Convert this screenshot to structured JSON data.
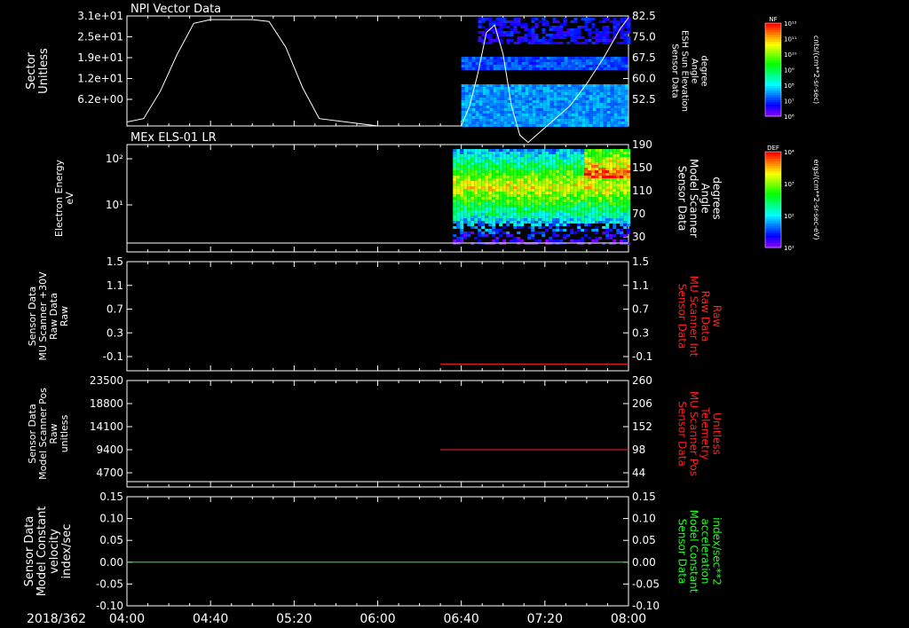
{
  "panels": [
    {
      "title": "NPI Vector Data",
      "left_label": [
        "Sector",
        "Unitless"
      ],
      "left_ticks": [
        "3.1e+01",
        "2.5e+01",
        "1.9e+01",
        "1.2e+01",
        "6.2e+00"
      ],
      "right_label": [
        "Sensor Data",
        "ESH Sun Elevation",
        "Angle",
        "degree"
      ],
      "right_ticks": [
        "82.5",
        "75.0",
        "67.5",
        "60.0",
        "52.5"
      ],
      "colorbar": {
        "label": "NF",
        "unit": "cnts/(cm**2-sr-sec)",
        "ticks": [
          "10¹²",
          "10¹¹",
          "10¹⁰",
          "10⁹",
          "10⁸",
          "10⁷",
          "10⁶"
        ]
      }
    },
    {
      "title": "MEx ELS-01 LR",
      "left_label": [
        "Electron Energy",
        "eV"
      ],
      "left_ticks": [
        "10²",
        "10¹"
      ],
      "right_label": [
        "Sensor Data",
        "Model Scanner",
        "Angle",
        "degrees"
      ],
      "right_ticks": [
        "190",
        "150",
        "110",
        "70",
        "30"
      ],
      "colorbar": {
        "label": "DEF",
        "unit": "ergs/(cm**2-sr-sec-eV)",
        "ticks": [
          "10⁴",
          "10³",
          "10²",
          "10¹"
        ]
      }
    },
    {
      "title": "",
      "left_label": [
        "Sensor Data",
        "MU Scanner +30V",
        "Raw Data",
        "Raw"
      ],
      "left_ticks": [
        "1.5",
        "1.1",
        "0.7",
        "0.3",
        "-0.1"
      ],
      "right_label": [
        "Sensor Data",
        "MU Scanner Int",
        "Raw Data",
        "Raw"
      ],
      "right_ticks": [
        "1.5",
        "1.1",
        "0.7",
        "0.3",
        "-0.1"
      ]
    },
    {
      "title": "",
      "left_label": [
        "Sensor Data",
        "Model Scanner Pos",
        "Raw",
        "unitless"
      ],
      "left_ticks": [
        "23500",
        "18800",
        "14100",
        "9400",
        "4700"
      ],
      "right_label": [
        "Sensor Data",
        "MU Scanner Pos",
        "Telemetry",
        "Unitless"
      ],
      "right_ticks": [
        "260",
        "206",
        "152",
        "98",
        "44"
      ]
    },
    {
      "title": "",
      "left_label": [
        "Sensor Data",
        "Model Constant",
        "velocity",
        "index/sec"
      ],
      "left_ticks": [
        "0.15",
        "0.10",
        "0.05",
        "0.00",
        "-0.05",
        "-0.10"
      ],
      "right_label": [
        "Sensor Data",
        "Model Constant",
        "acceleration",
        "index/sec**2"
      ],
      "right_ticks": [
        "0.15",
        "0.10",
        "0.05",
        "0.00",
        "-0.05",
        "-0.10"
      ]
    }
  ],
  "x_axis": {
    "date": "2018/362",
    "ticks": [
      "04:00",
      "04:40",
      "05:20",
      "06:00",
      "06:40",
      "07:20",
      "08:00"
    ]
  },
  "colors": {
    "background": "#000000",
    "axis": "#ffffff",
    "red_trace": "#ff2020",
    "green_trace": "#20ff20"
  },
  "chart_data": [
    {
      "type": "line",
      "title": "NPI Vector Data",
      "xlabel": "2018/362",
      "ylabel": "Sector Unitless",
      "y2label": "Sensor Data ESH Sun Elevation Angle degree",
      "xlim": [
        "04:00",
        "08:00"
      ],
      "ylim": [
        6.2,
        31
      ],
      "y2lim": [
        52.5,
        82.5
      ],
      "series": [
        {
          "name": "Sensor Data ESH Sun Elevation Angle",
          "x": [
            "04:00",
            "04:08",
            "04:16",
            "04:24",
            "04:32",
            "04:40",
            "05:00",
            "05:08",
            "05:16",
            "05:24",
            "05:32",
            "06:00",
            "06:20",
            "06:40",
            "06:44",
            "06:48",
            "06:52",
            "06:56",
            "07:00",
            "07:04",
            "07:08",
            "07:12",
            "07:16",
            "07:24",
            "07:32",
            "07:40",
            "07:48",
            "07:56",
            "08:00"
          ],
          "y": [
            53.6,
            54.5,
            62,
            72,
            80.5,
            81.5,
            81.5,
            81,
            74,
            63,
            54.5,
            52.5,
            52.5,
            52.5,
            58,
            67,
            78,
            80,
            72,
            58,
            50,
            48,
            50,
            54,
            58,
            64,
            71,
            79,
            82
          ]
        }
      ]
    },
    {
      "type": "heatmap",
      "title": "MEx ELS-01 LR",
      "ylabel": "Electron Energy eV",
      "y2label": "Sensor Data Model Scanner Angle degrees",
      "xlim": [
        "04:00",
        "08:00"
      ],
      "y_scale": "log",
      "y2lim": [
        30,
        190
      ],
      "data_start": "06:36",
      "data_end": "08:00"
    },
    {
      "type": "line",
      "ylabel": "Sensor Data MU Scanner +30V Raw Data Raw",
      "y2label": "Sensor Data MU Scanner Int Raw Data Raw",
      "ylim": [
        -0.1,
        1.5
      ],
      "series": [
        {
          "name": "Sensor Data MU Scanner Int Raw Data",
          "x": [
            "06:30",
            "08:00"
          ],
          "y": [
            0.0,
            0.0
          ]
        }
      ]
    },
    {
      "type": "line",
      "ylabel": "Sensor Data Model Scanner Pos Raw unitless",
      "y2label": "Sensor Data MU Scanner Pos Telemetry Unitless",
      "y2lim": [
        44,
        260
      ],
      "series": [
        {
          "name": "Sensor Data MU Scanner Pos Telemetry",
          "x": [
            "06:30",
            "08:00"
          ],
          "y": [
            98,
            98
          ]
        }
      ]
    },
    {
      "type": "line",
      "ylabel": "Sensor Data Model Constant velocity index/sec",
      "y2label": "Sensor Data Model Constant acceleration index/sec**2",
      "ylim": [
        -0.1,
        0.15
      ],
      "series": [
        {
          "name": "Sensor Data Model Constant acceleration",
          "x": [
            "04:00",
            "08:00"
          ],
          "y": [
            0.0,
            0.0
          ]
        }
      ]
    }
  ]
}
